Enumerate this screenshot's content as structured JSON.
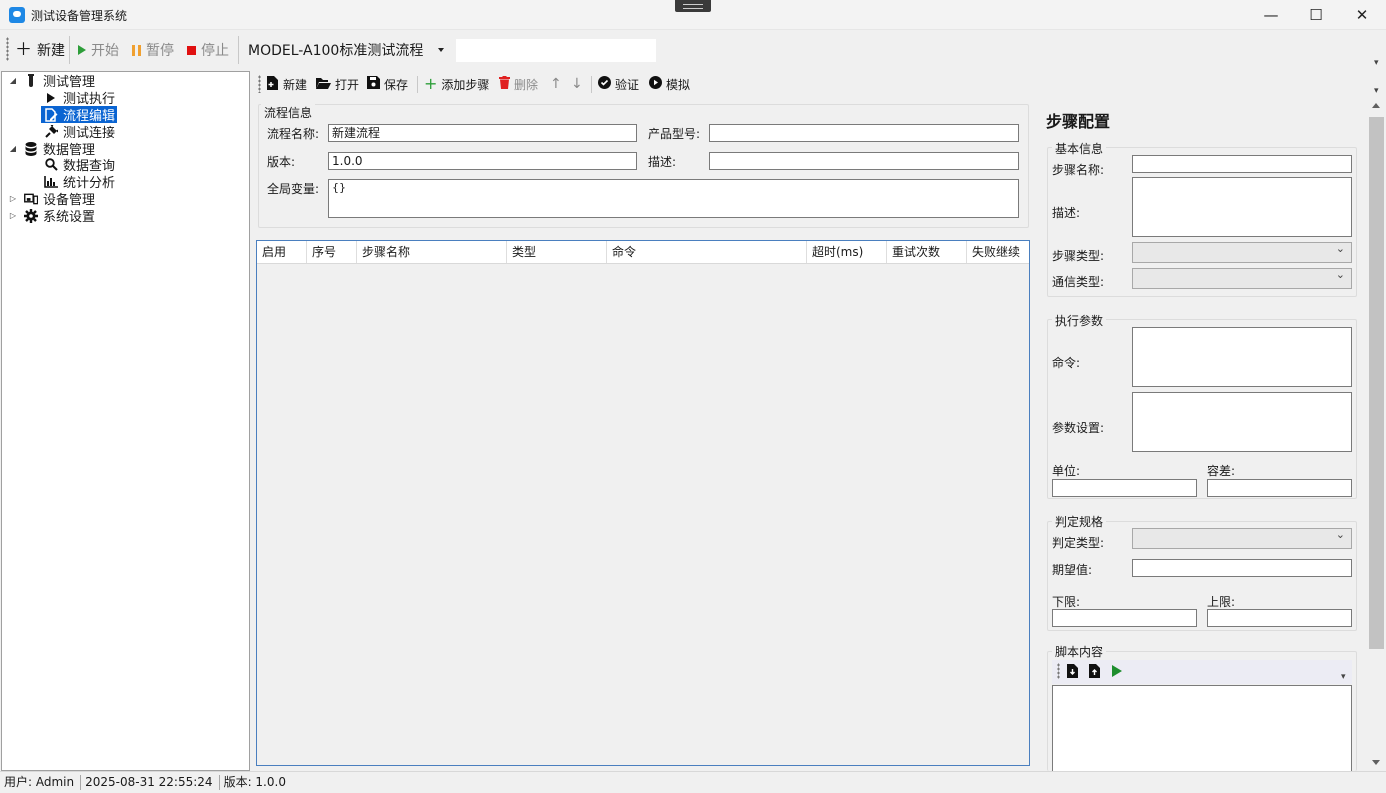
{
  "window": {
    "title": "测试设备管理系统",
    "minimize": "—",
    "maximize": "☐",
    "close": "✕"
  },
  "toolbar": {
    "new": "新建",
    "start": "开始",
    "pause": "暂停",
    "stop": "停止",
    "flow_select": "MODEL-A100标准测试流程",
    "search_value": ""
  },
  "tree": {
    "test_mgmt": "测试管理",
    "test_exec": "测试执行",
    "flow_edit": "流程编辑",
    "test_conn": "测试连接",
    "data_mgmt": "数据管理",
    "data_query": "数据查询",
    "stats": "统计分析",
    "device_mgmt": "设备管理",
    "sys_settings": "系统设置"
  },
  "work_toolbar": {
    "new": "新建",
    "open": "打开",
    "save": "保存",
    "add_step": "添加步骤",
    "delete": "删除",
    "validate": "验证",
    "simulate": "模拟"
  },
  "flow_info": {
    "group_title": "流程信息",
    "name_label": "流程名称:",
    "name_value": "新建流程",
    "product_label": "产品型号:",
    "product_value": "",
    "version_label": "版本:",
    "version_value": "1.0.0",
    "desc_label": "描述:",
    "desc_value": "",
    "vars_label": "全局变量:",
    "vars_value": "{}"
  },
  "grid": {
    "columns": [
      "启用",
      "序号",
      "步骤名称",
      "类型",
      "命令",
      "超时(ms)",
      "重试次数",
      "失败继续"
    ]
  },
  "step_config": {
    "title": "步骤配置",
    "basic": {
      "title": "基本信息",
      "name_label": "步骤名称:",
      "desc_label": "描述:",
      "type_label": "步骤类型:",
      "comm_label": "通信类型:"
    },
    "exec": {
      "title": "执行参数",
      "cmd_label": "命令:",
      "param_label": "参数设置:",
      "unit_label": "单位:",
      "tol_label": "容差:"
    },
    "judge": {
      "title": "判定规格",
      "type_label": "判定类型:",
      "expected_label": "期望值:",
      "lower_label": "下限:",
      "upper_label": "上限:"
    },
    "script": {
      "title": "脚本内容"
    }
  },
  "status": {
    "user": "用户: Admin",
    "time": "2025-08-31 22:55:24",
    "version": "版本: 1.0.0"
  }
}
